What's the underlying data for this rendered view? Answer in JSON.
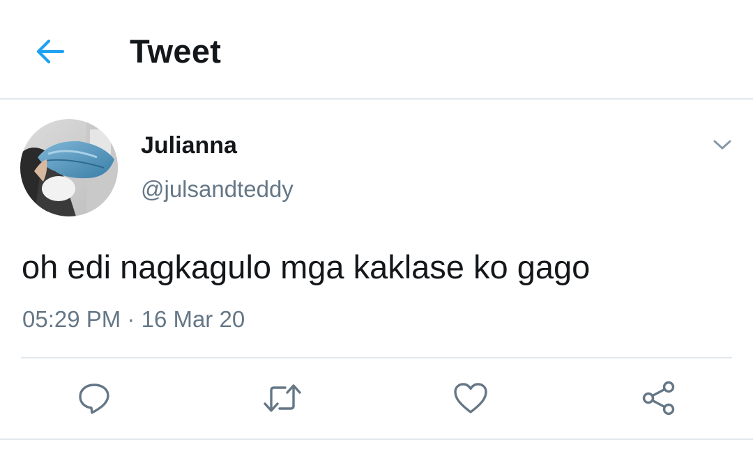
{
  "header": {
    "title": "Tweet",
    "back_icon": "arrow-left-icon",
    "accent_color": "#1da1f2"
  },
  "tweet": {
    "author": {
      "display_name": "Julianna",
      "handle": "@julsandteddy",
      "avatar": "avatar-photo"
    },
    "text": "oh edi nagkagulo mga kaklase ko gago",
    "time": "05:29 PM",
    "separator": "·",
    "date": "16 Mar 20",
    "menu_icon": "chevron-down-icon"
  },
  "actions": [
    {
      "name": "reply",
      "icon": "reply-icon"
    },
    {
      "name": "retweet",
      "icon": "retweet-icon"
    },
    {
      "name": "like",
      "icon": "heart-icon"
    },
    {
      "name": "share",
      "icon": "share-icon"
    }
  ],
  "colors": {
    "text_primary": "#14171a",
    "text_secondary": "#657786",
    "border": "#e1e8ed"
  }
}
